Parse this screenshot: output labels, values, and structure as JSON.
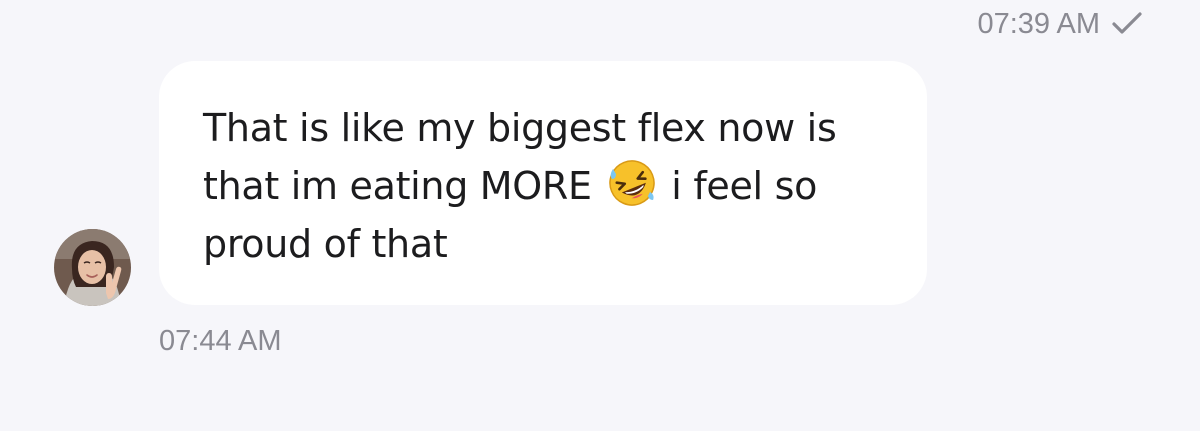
{
  "sent_message": {
    "time": "07:39 AM",
    "status_icon": "check-icon"
  },
  "received_message": {
    "lines": [
      "That is like my biggest flex now is",
      "that im eating MORE",
      "i feel so",
      "proud of that"
    ],
    "emoji": "rolling-on-the-floor-laughing",
    "time": "07:44 AM",
    "sender_avatar": "avatar"
  },
  "colors": {
    "background": "#f6f6fa",
    "bubble": "#ffffff",
    "text": "#1c1c1e",
    "timestamp": "#8a8a92"
  }
}
